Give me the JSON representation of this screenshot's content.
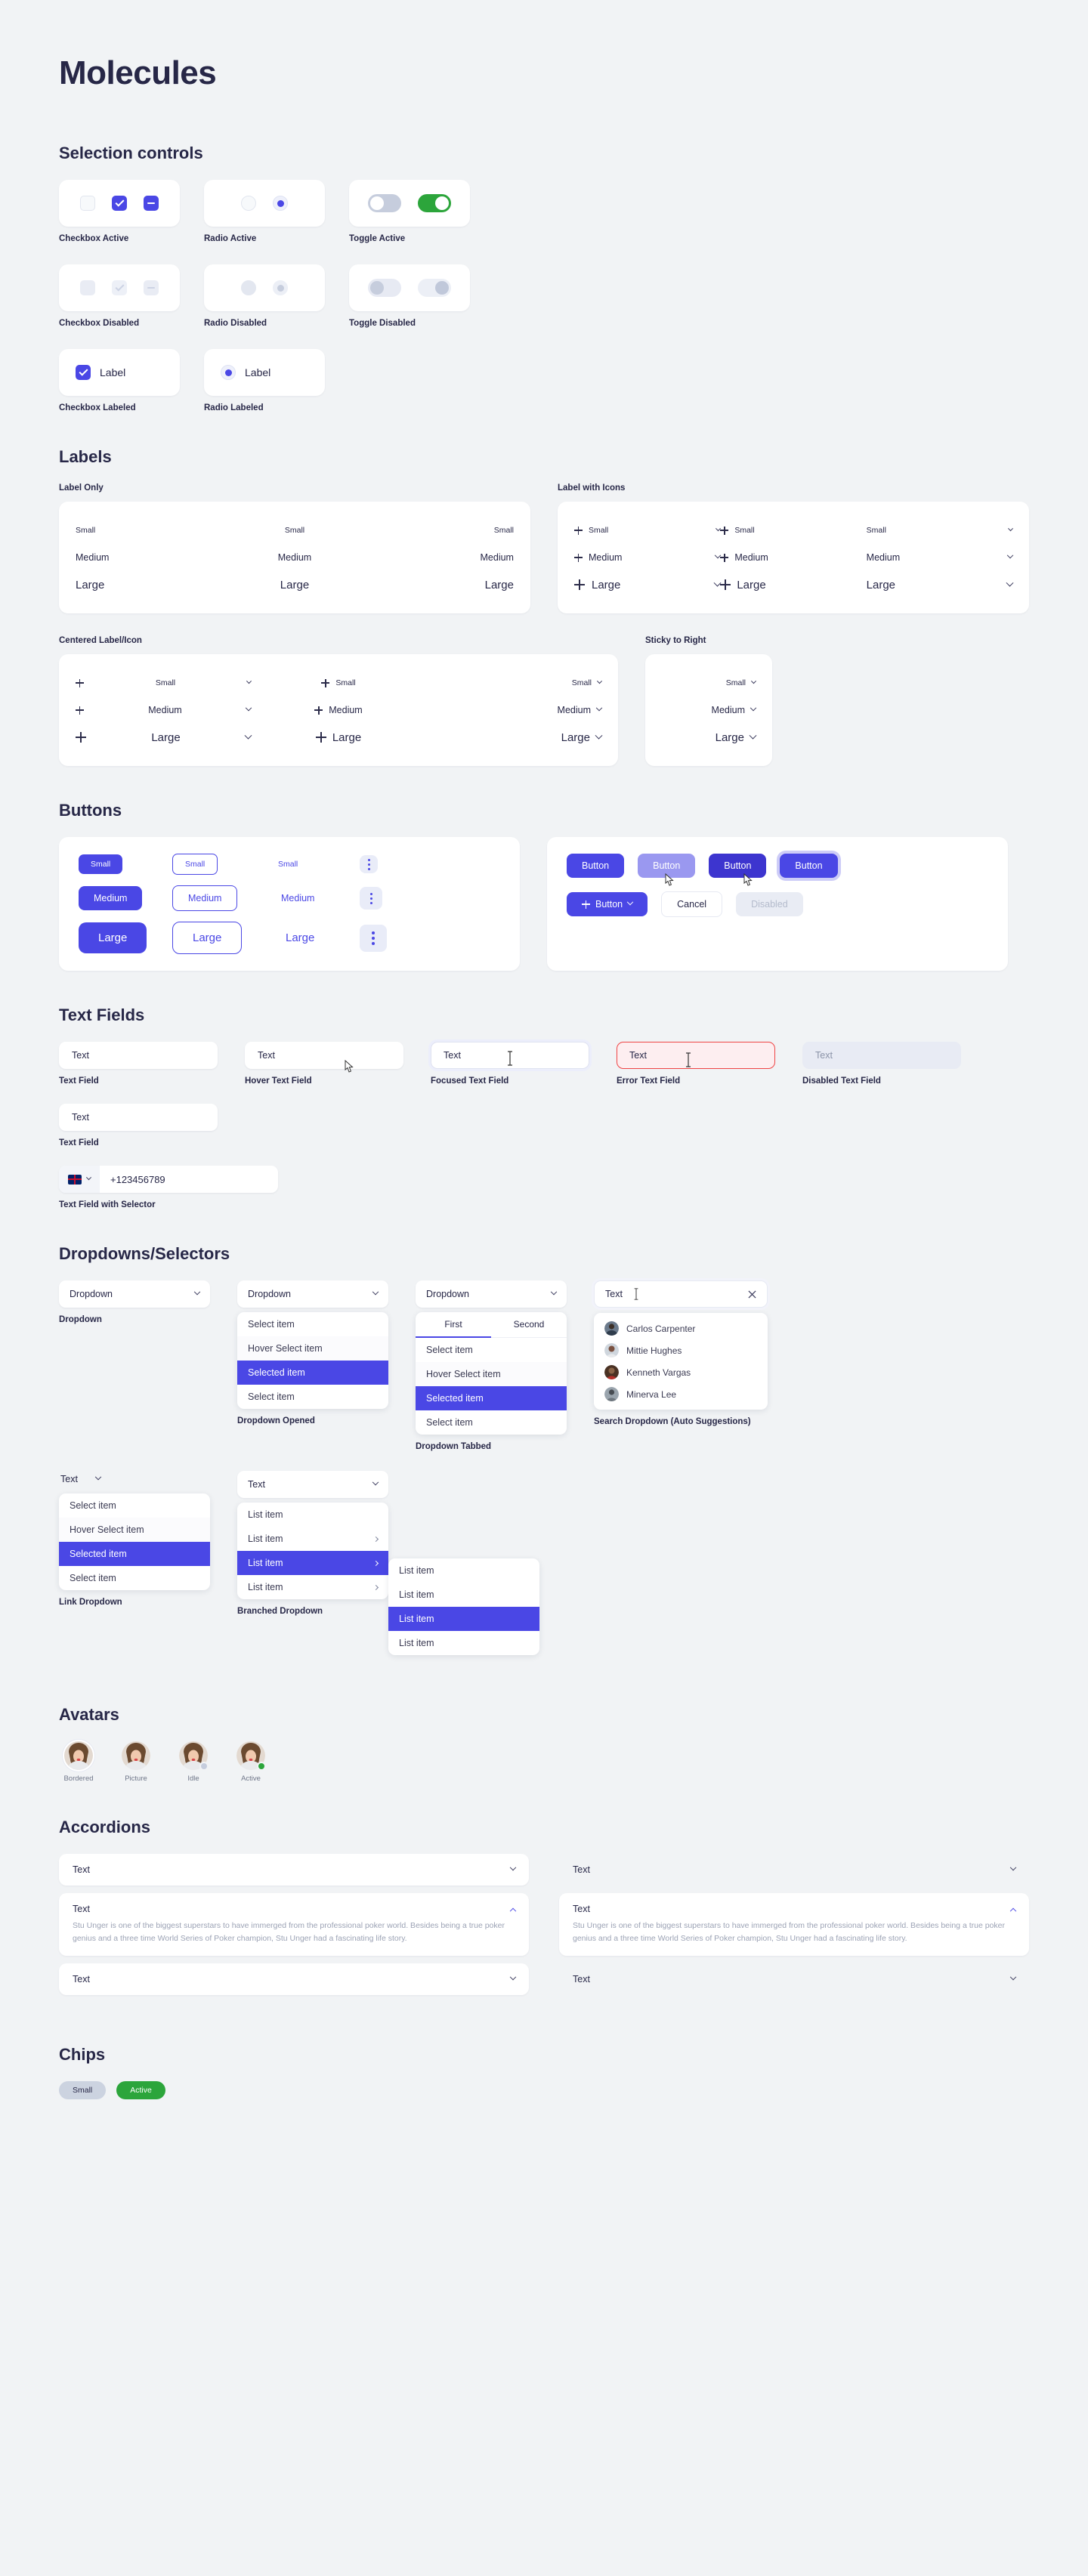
{
  "page": {
    "title": "Molecules"
  },
  "sections": {
    "selection_controls": {
      "title": "Selection controls",
      "cells": [
        {
          "caption": "Checkbox Active"
        },
        {
          "caption": "Radio Active"
        },
        {
          "caption": "Toggle Active"
        },
        {
          "caption": "Checkbox Disabled"
        },
        {
          "caption": "Radio Disabled"
        },
        {
          "caption": "Toggle Disabled"
        },
        {
          "caption": "Checkbox Labeled",
          "label": "Label"
        },
        {
          "caption": "Radio Labeled",
          "label": "Label"
        }
      ]
    },
    "labels": {
      "title": "Labels",
      "groups": [
        {
          "heading": "Label Only"
        },
        {
          "heading": "Label with Icons"
        },
        {
          "heading": "Centered Label/Icon"
        },
        {
          "heading": "Sticky to Right"
        }
      ],
      "sizes": {
        "small": "Small",
        "medium": "Medium",
        "large": "Large"
      }
    },
    "buttons": {
      "title": "Buttons",
      "sizes": {
        "small": "Small",
        "medium": "Medium",
        "large": "Large"
      },
      "states": {
        "default": "Button",
        "hover": "Button",
        "pressed": "Button",
        "focus": "Button",
        "with_icon": "Button",
        "cancel": "Cancel",
        "disabled": "Disabled"
      }
    },
    "text_fields": {
      "title": "Text Fields",
      "value": "Text",
      "captions": {
        "default": "Text Field",
        "hover": "Hover Text Field",
        "focused": "Focused Text Field",
        "error": "Error Text Field",
        "disabled": "Disabled Text Field",
        "second_default": "Text Field",
        "with_selector": "Text Field with Selector"
      },
      "phone": {
        "value": "+123456789",
        "flag": "uk-flag-icon"
      }
    },
    "dropdowns": {
      "title": "Dropdowns/Selectors",
      "trigger_label": "Dropdown",
      "text_label": "Text",
      "captions": {
        "plain": "Dropdown",
        "opened": "Dropdown Opened",
        "tabbed": "Dropdown Tabbed",
        "search": "Search Dropdown (Auto Suggestions)",
        "link": "Link Dropdown",
        "branched": "Branched Dropdown"
      },
      "items": {
        "select": "Select item",
        "hover": "Hover Select item",
        "selected": "Selected item",
        "list": "List item"
      },
      "tabs": [
        "First",
        "Second"
      ],
      "suggestions": [
        {
          "name": "Carlos Carpenter"
        },
        {
          "name": "Mittie Hughes"
        },
        {
          "name": "Kenneth Vargas"
        },
        {
          "name": "Minerva Lee"
        }
      ]
    },
    "avatars": {
      "title": "Avatars",
      "items": [
        {
          "caption": "Bordered"
        },
        {
          "caption": "Picture"
        },
        {
          "caption": "Idle"
        },
        {
          "caption": "Active"
        }
      ]
    },
    "accordions": {
      "title": "Accordions",
      "head": "Text",
      "body": "Stu Unger is one of the biggest superstars to have immerged from the professional poker world. Besides being a true poker genius and a three time World Series of Poker champion, Stu Unger had a fascinating life story."
    },
    "chips": {
      "title": "Chips",
      "items": [
        {
          "label": "Small",
          "state": "default"
        },
        {
          "label": "Active",
          "state": "active"
        }
      ]
    }
  },
  "colors": {
    "primary": "#4a47e5",
    "primary_hover": "#9a98f0",
    "primary_pressed": "#3d35cf",
    "success": "#2ca53b",
    "error": "#ef4444",
    "background": "#f1f3f5",
    "surface": "#ffffff",
    "text": "#272747",
    "muted": "#9ca3b5"
  }
}
